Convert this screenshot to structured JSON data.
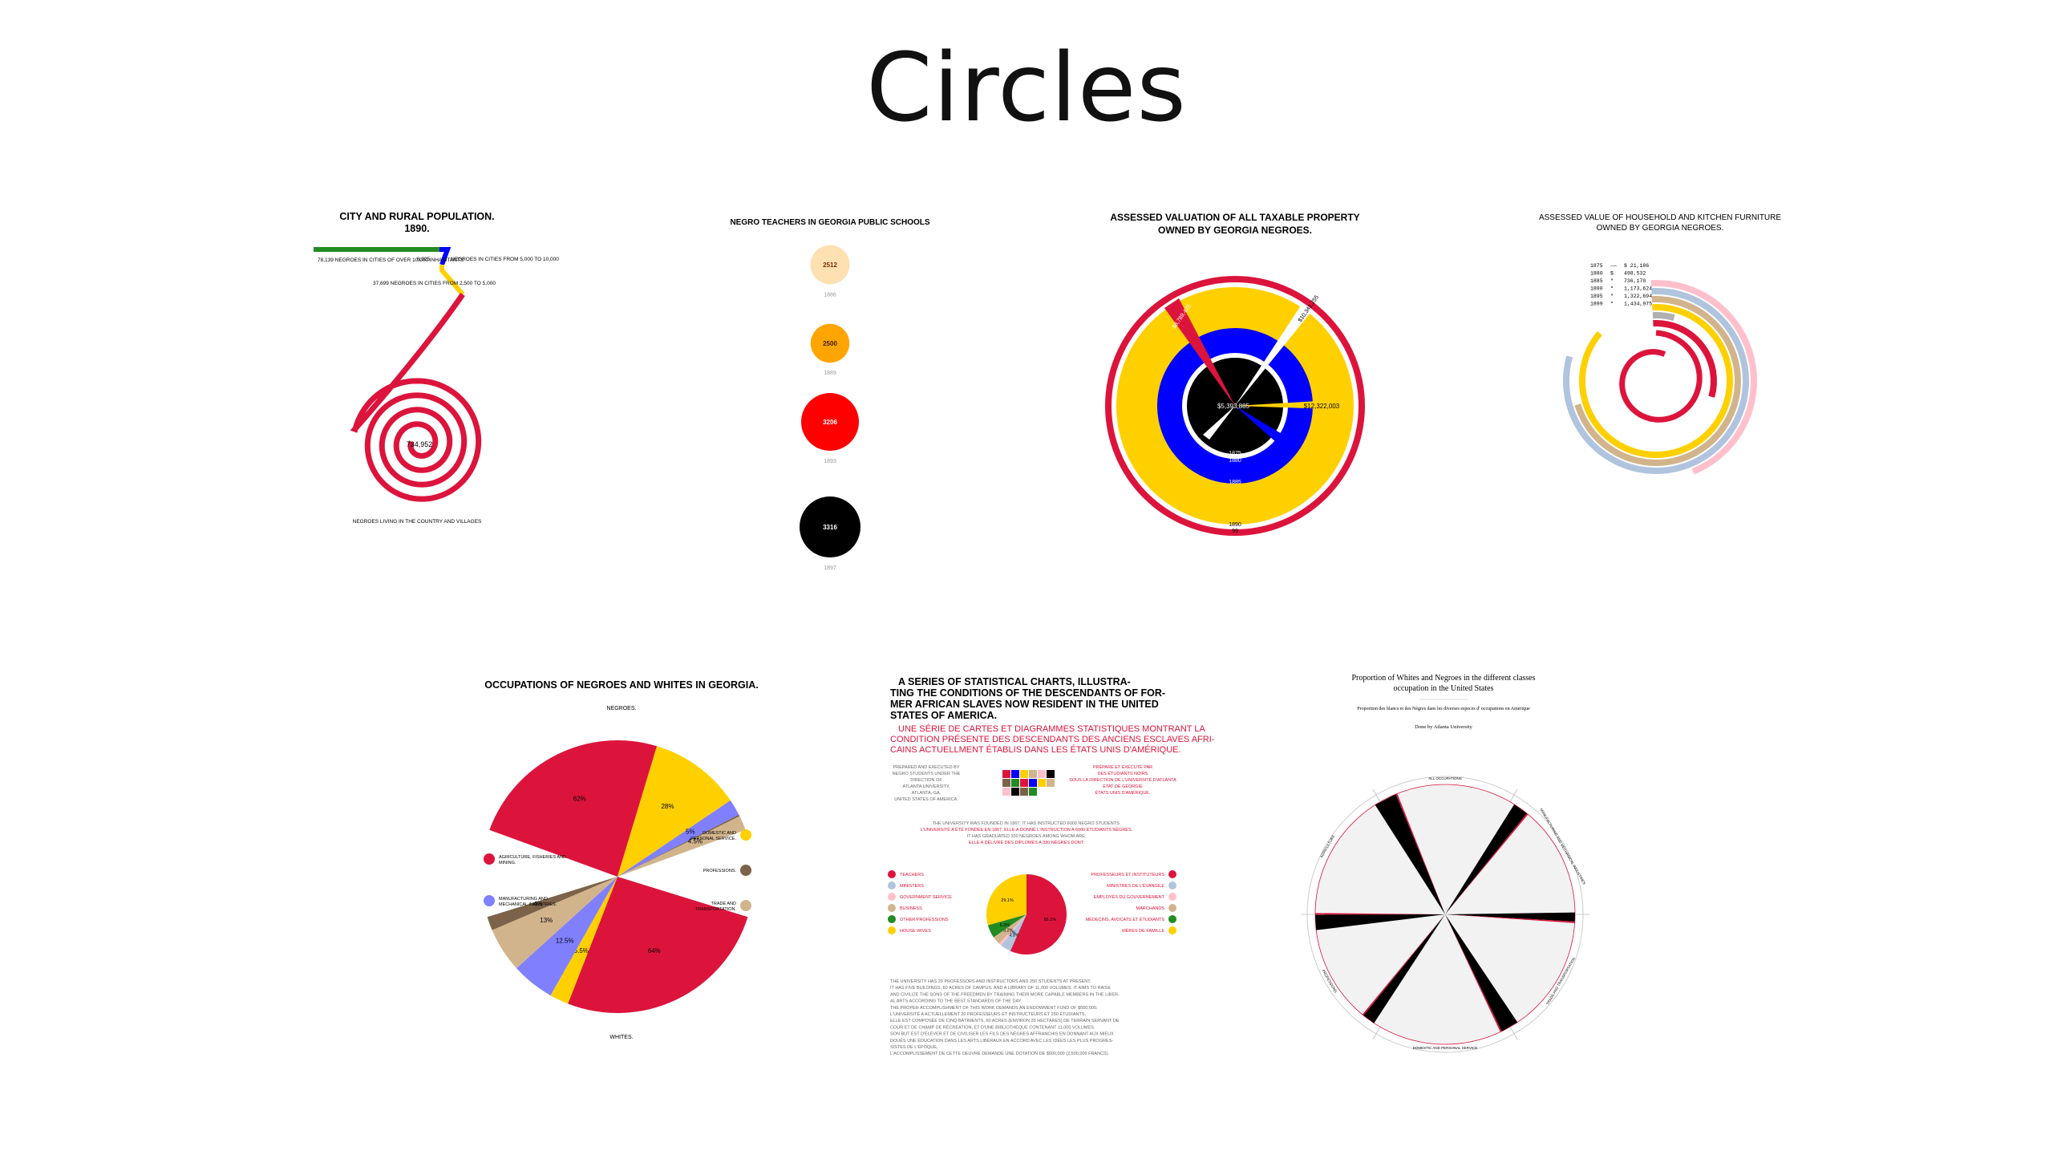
{
  "page": {
    "title": "Circles"
  },
  "colors": {
    "red": "#dc143c",
    "gold": "#ffd000",
    "blue": "#0000ff",
    "black": "#000000",
    "tan": "#d2b48c",
    "brown": "#7b6248",
    "lavender": "#8080ff",
    "peach": "#ffe0b0",
    "orange": "#ffa500",
    "grey": "#b0b0b0",
    "lightblue": "#b0c4de"
  },
  "chart_data": [
    {
      "id": "city-rural",
      "type": "spiral",
      "title": "CITY AND RURAL POPULATION.",
      "subtitle": "1890.",
      "segments": [
        {
          "label": "78,139 NEGROES IN CITIES OF OVER 10,000 INHABITANTS",
          "value": 78139,
          "color": "#228b22"
        },
        {
          "label": "NEGROES IN CITIES FROM 5,000 TO 10,000",
          "value": 8025,
          "value_label": "8,025",
          "color": "#0000ff"
        },
        {
          "label": "37,699 NEGROES IN CITIES FROM 2,500 TO 5,000",
          "value": 37699,
          "color": "#ffd000"
        },
        {
          "label": "NEGROES LIVING IN THE COUNTRY AND VILLAGES",
          "value": 734952,
          "value_label": "734,952",
          "color": "#dc143c"
        }
      ]
    },
    {
      "id": "teachers",
      "type": "bubble",
      "title": "NEGRO TEACHERS IN GEORGIA PUBLIC SCHOOLS",
      "points": [
        {
          "year": "1886",
          "value": 2512,
          "color": "#ffe0b0"
        },
        {
          "year": "1889",
          "value": 2500,
          "color": "#ffa500"
        },
        {
          "year": "1893",
          "value": 3206,
          "color": "#ff0000"
        },
        {
          "year": "1897",
          "value": 3316,
          "color": "#000000"
        }
      ]
    },
    {
      "id": "valuation",
      "type": "radial",
      "title_lines": [
        "ASSESSED VALUATION OF ALL TAXABLE PROPERTY",
        "OWNED BY GEORGIA NEGROES."
      ],
      "labels": [
        {
          "text": "$5,393,885",
          "year": ""
        },
        {
          "text": "$12,322,003",
          "year": ""
        },
        {
          "text": "$10,341,255",
          "year": ""
        },
        {
          "text": "$8,789,425",
          "year": ""
        },
        {
          "text": "1875",
          "year": ""
        },
        {
          "text": "1880",
          "year": ""
        },
        {
          "text": "1885",
          "year": ""
        },
        {
          "text": "1890",
          "year": ""
        },
        {
          "text": "99",
          "year": ""
        }
      ]
    },
    {
      "id": "furniture",
      "type": "spiral-bars",
      "title_lines": [
        "ASSESSED VALUE OF HOUSEHOLD AND KITCHEN FURNITURE",
        "OWNED BY GEORGIA NEGROES."
      ],
      "rows": [
        {
          "year": "1875",
          "marker": "——",
          "value": "$ 21,186"
        },
        {
          "year": "1880",
          "marker": "$",
          "value": "498,532"
        },
        {
          "year": "1885",
          "marker": "\"",
          "value": "736,170"
        },
        {
          "year": "1890",
          "marker": "\"",
          "value": "1,173,624"
        },
        {
          "year": "1895",
          "marker": "\"",
          "value": "1,322,694"
        },
        {
          "year": "1899",
          "marker": "\"",
          "value": "1,434,975"
        }
      ],
      "values": [
        21186,
        498532,
        736170,
        1173624,
        1322694,
        1434975
      ]
    },
    {
      "id": "occupations",
      "type": "pie",
      "title": "OCCUPATIONS OF NEGROES AND WHITES IN GEORGIA.",
      "top_label": "NEGROES.",
      "bottom_label": "WHITES.",
      "categories": [
        "AGRICULTURE, FISHERIES AND MINING.",
        "DOMESTIC AND PERSONAL SERVICE.",
        "MANUFACTURING AND MECHANICAL INDUSTRIES.",
        "PROFESSIONS.",
        "TRADE AND TRANSPORTATION."
      ],
      "legend_left": [
        {
          "label": "AGRICULTURE, FISHERIES AND MINING.",
          "color": "#dc143c"
        },
        {
          "label": "MANUFACTURING AND MECHANICAL INDUSTRIES.",
          "color": "#8080ff"
        }
      ],
      "legend_right": [
        {
          "label": "DOMESTIC AND PERSONAL SERVICE.",
          "color": "#ffd000"
        },
        {
          "label": "PROFESSIONS.",
          "color": "#7b6248"
        },
        {
          "label": "TRADE AND TRANSPORTATION.",
          "color": "#d2b48c"
        }
      ],
      "series": [
        {
          "name": "NEGROES.",
          "values": [
            62,
            28,
            5,
            0.5,
            4.5
          ],
          "labels": [
            "62%",
            "28%",
            "5%",
            "",
            "4.5%"
          ]
        },
        {
          "name": "WHITES.",
          "values": [
            64,
            5.5,
            12.5,
            4,
            13
          ],
          "labels": [
            "64%",
            "5.5%",
            "12.5%",
            "4%",
            "13%"
          ]
        }
      ]
    },
    {
      "id": "series-title",
      "type": "pie",
      "title_lines": [
        "A SERIES OF STATISTICAL CHARTS, ILLUSTRA-",
        "TING THE CONDITIONS OF THE DESCENDANTS OF FOR-",
        "MER AFRICAN SLAVES NOW RESIDENT IN THE UNITED",
        "STATES OF AMERICA."
      ],
      "french_lines": [
        "UNE SÉRIE DE CARTES ET  DIAGRAMMES STATISTIQUES MONTRANT LA",
        "CONDITION PRÉSENTE DES DESCENDANTS DES ANCIENS ESCLAVES AFRI-",
        "CAINS  ACTUELLMENT ÉTABLIS DANS LES ÉTATS UNIS D'AMÉRIQUE."
      ],
      "left_note": [
        "PREPARED AND EXECUTED BY",
        "NEGRO STUDENTS UNDER THE",
        "DIRECTION OF",
        "ATLANTA UNIVERSITY.",
        "ATLANTA, GA.",
        "UNITED STATES OF AMERICA."
      ],
      "right_note": [
        "PRÉPARÉ ET EXÉCUTÉ PAR",
        "DES ÉTUDIANTS NOIRS",
        "SOUS LA DIRECTION DE L'UNIVERSITÉ D'ATLANTA",
        "ÉTAT DE GÉORGIE",
        "ÉTATS UNIS D'AMÉRIQUE."
      ],
      "center_note": [
        "THE UNIVERSITY WAS FOUNDED IN 1867. IT HAS INSTRUCTED 6000 NEGRO STUDENTS.",
        "L'UNIVERSITÉ A ÉTÉ FONDÉE EN 1867. ELLE A DONNÉ L'INSTRUCTION A 6000 ÉTUDIANTS NÈGRES.",
        "IT HAS GRADUATED 330 NEGROES AMONG WHOM ARE:",
        "ELLE A DÉLIVRÉ DES DIPLOMES A 330 NÈGRES DONT:"
      ],
      "legend_left": [
        {
          "label": "TEACHERS",
          "color": "#dc143c"
        },
        {
          "label": "MINISTERS",
          "color": "#b0c4de"
        },
        {
          "label": "GOVERNMENT SERVICE",
          "color": "#ffc0cb"
        },
        {
          "label": "BUSINESS",
          "color": "#d2b48c"
        },
        {
          "label": "OTHER PROFESSIONS",
          "color": "#228b22"
        },
        {
          "label": "HOUSE WIVES",
          "color": "#ffd000"
        }
      ],
      "legend_right": [
        {
          "label": "PROFESSEURS ET INSTITUTEURS",
          "color": "#dc143c"
        },
        {
          "label": "MINISTRES DE L'ÉVANGILE",
          "color": "#b0c4de"
        },
        {
          "label": "EMPLOYÉS DU GOUVERNEMENT",
          "color": "#ffc0cb"
        },
        {
          "label": "MARCHANDS",
          "color": "#d2b48c"
        },
        {
          "label": "MÉDECINS, AVOCATS ET ÉTUDIANTS",
          "color": "#228b22"
        },
        {
          "label": "MÈRES DE FAMILLE",
          "color": "#ffd000"
        }
      ],
      "values": [
        56.1,
        4.3,
        1.1,
        3.2,
        5.3,
        29.1
      ],
      "labels": [
        "56.1%",
        "4.3%",
        "1.1%",
        "3.2%",
        "5.3%",
        "29.1%"
      ],
      "footer": [
        "THE UNIVERSITY HAS 20 PROFESSORS AND INSTRUCTORS AND 250 STUDENTS AT PRESENT.",
        "IT HAS FIVE BUILDINGS, 60 ACRES OF CAMPUS, AND A LIBRARY OF 11,000 VOLUMES. IT AIMS TO RAISE",
        "AND CIVILIZE THE SONS OF THE FREEDMEN BY TRAINING THEIR MORE CAPABLE MEMBERS IN THE LIBER-",
        "AL ARTS ACCORDING TO THE BEST STANDARDS OF THE DAY.",
        "THE PROPER ACCOMPLISHMENT OF THIS WORK DEMANDS AN ENDOWMENT FUND OF $500,000.",
        "L'UNIVERSITÉ A ACTUELLEMENT 20 PROFESSEURS ET INSTRUCTEURS ET 250 ÉTUDIANTS.",
        "ELLE EST COMPOSÉE DE CINQ BÂTIMENTS, 60 ACRES (ENVIRON 26 HECTARES) DE TERRAIN SERVANT DE",
        "COUR ET DE CHAMP DE RÉCRÉATION, ET D'UNE BIBLIOTHÈQUE CONTENANT 11,000 VOLUMES.",
        "SON BUT EST D'ÉLEVER ET DE CIVILISER LES FILS DES NÈGRES AFFRANCHIS EN DONNANT AUX MIEUX",
        "DOUÉS UNE ÉDUCATION DANS LES ARTS LIBÉRAUX EN ACCORD AVEC LES IDÉES LES PLUS PROGRES-",
        "SISTES DE L'ÉPOQUE.",
        "L'ACCOMPLISSEMENT DE CETTE OEUVRE DEMANDE UNE DOTATION DE $500,000 (2,500,000 FRANCS)."
      ]
    },
    {
      "id": "proportion",
      "type": "radial-wedges",
      "title_lines": [
        "Proportion of Whites and Negroes in the different classes",
        "occupation in the United States"
      ],
      "subtitle": "Proportion des blancs et des Nègres dans les diverses especes d' occupations en Amerique",
      "credit": "Done by Atlanta University",
      "sections": [
        "ALL OCCUPATIONS",
        "MANUFACTURING AND MECHANICAL INDUSTRIES",
        "TRADE AND TRANSPORTATION",
        "DOMESTIC AND PERSONAL SERVICE",
        "PROFESSIONS",
        "AGRICULTURE"
      ]
    }
  ]
}
